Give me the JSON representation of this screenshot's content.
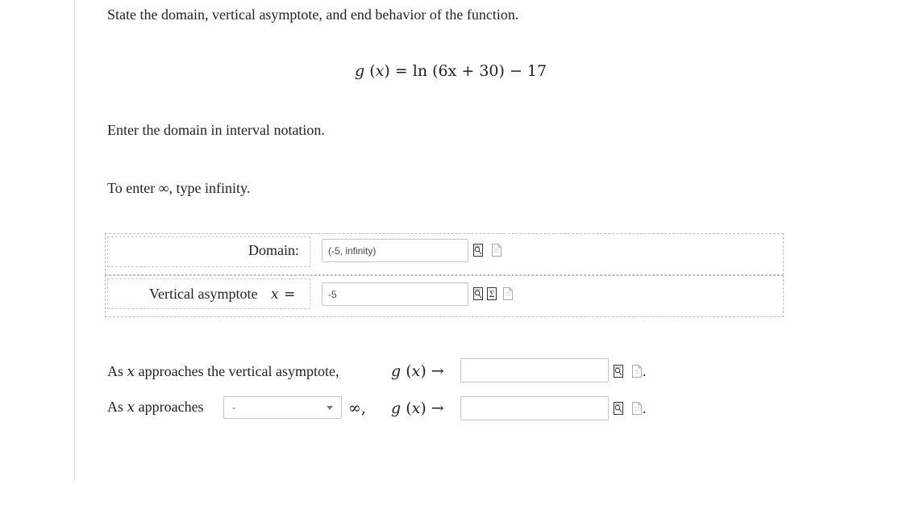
{
  "question": {
    "prompt": "State the domain, vertical asymptote, and end behavior of the function.",
    "function": {
      "lhs_name": "g",
      "lhs_var": "x",
      "rhs": "= ln (6x + 30) − 17"
    },
    "domain_instruction": "Enter the domain in interval notation.",
    "infinity_hint": "To enter ∞, type infinity."
  },
  "answers": {
    "domain": {
      "label": "Domain:",
      "value": "(-5, infinity)"
    },
    "vertical_asymptote": {
      "label": "Vertical asymptote",
      "var": "x",
      "eq": "=",
      "value": "-5"
    }
  },
  "end_behavior": {
    "row1": {
      "label_prefix": "As",
      "var": "x",
      "label_suffix": "approaches the vertical asymptote,",
      "fn": "g",
      "fn_var": "x",
      "arrow": "→",
      "value": "",
      "period": "."
    },
    "row2": {
      "label_prefix": "As",
      "var": "x",
      "label_suffix": "approaches",
      "select_value": "-",
      "infinity": "∞,",
      "fn": "g",
      "fn_var": "x",
      "arrow": "→",
      "value": "",
      "period": "."
    }
  },
  "icons": {
    "preview": "preview-icon",
    "help": "help-document-icon",
    "equation_editor": "equation-editor-icon"
  }
}
